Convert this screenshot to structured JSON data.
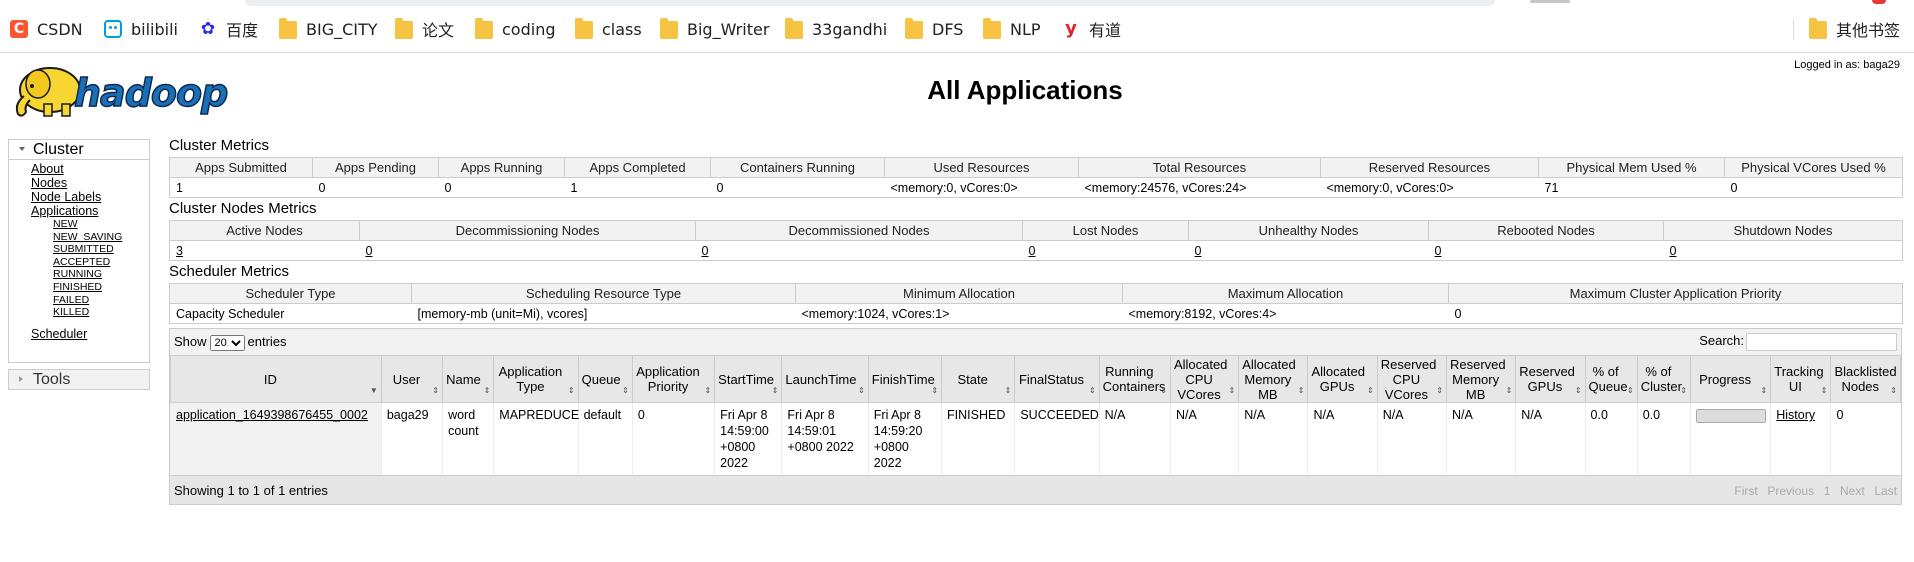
{
  "bookmarks": [
    {
      "label": "CSDN",
      "icon": "csdn-icon"
    },
    {
      "label": "bilibili",
      "icon": "bilibili-icon"
    },
    {
      "label": "百度",
      "icon": "baidu-icon"
    },
    {
      "label": "BIG_CITY",
      "icon": "folder-icon"
    },
    {
      "label": "论文",
      "icon": "folder-icon"
    },
    {
      "label": "coding",
      "icon": "folder-icon"
    },
    {
      "label": "class",
      "icon": "folder-icon"
    },
    {
      "label": "Big_Writer",
      "icon": "folder-icon"
    },
    {
      "label": "33gandhi",
      "icon": "folder-icon"
    },
    {
      "label": "DFS",
      "icon": "folder-icon"
    },
    {
      "label": "NLP",
      "icon": "folder-icon"
    },
    {
      "label": "有道",
      "icon": "youdao-icon"
    }
  ],
  "other_bookmarks": "其他书签",
  "page": {
    "title": "All Applications",
    "logged_in": "Logged in as: baga29",
    "logo_alt": "hadoop"
  },
  "nav": {
    "cluster": "Cluster",
    "cluster_links": [
      "About",
      "Nodes",
      "Node Labels",
      "Applications"
    ],
    "app_states": [
      "NEW",
      "NEW_SAVING",
      "SUBMITTED",
      "ACCEPTED",
      "RUNNING",
      "FINISHED",
      "FAILED",
      "KILLED"
    ],
    "scheduler": "Scheduler",
    "tools": "Tools"
  },
  "cluster_metrics": {
    "title": "Cluster Metrics",
    "headers": [
      "Apps Submitted",
      "Apps Pending",
      "Apps Running",
      "Apps Completed",
      "Containers Running",
      "Used Resources",
      "Total Resources",
      "Reserved Resources",
      "Physical Mem Used %",
      "Physical VCores Used %"
    ],
    "values": [
      "1",
      "0",
      "0",
      "1",
      "0",
      "<memory:0, vCores:0>",
      "<memory:24576, vCores:24>",
      "<memory:0, vCores:0>",
      "71",
      "0"
    ]
  },
  "nodes_metrics": {
    "title": "Cluster Nodes Metrics",
    "headers": [
      "Active Nodes",
      "Decommissioning Nodes",
      "Decommissioned Nodes",
      "Lost Nodes",
      "Unhealthy Nodes",
      "Rebooted Nodes",
      "Shutdown Nodes"
    ],
    "values": [
      "3",
      "0",
      "0",
      "0",
      "0",
      "0",
      "0"
    ]
  },
  "scheduler_metrics": {
    "title": "Scheduler Metrics",
    "headers": [
      "Scheduler Type",
      "Scheduling Resource Type",
      "Minimum Allocation",
      "Maximum Allocation",
      "Maximum Cluster Application Priority"
    ],
    "values": [
      "Capacity Scheduler",
      "[memory-mb (unit=Mi), vcores]",
      "<memory:1024, vCores:1>",
      "<memory:8192, vCores:4>",
      "0"
    ]
  },
  "apps_table": {
    "show": "Show",
    "entries_value": "20",
    "entries": "entries",
    "search_label": "Search:",
    "headers": [
      "ID",
      "User",
      "Name",
      "Application Type",
      "Queue",
      "Application Priority",
      "StartTime",
      "LaunchTime",
      "FinishTime",
      "State",
      "FinalStatus",
      "Running Containers",
      "Allocated CPU VCores",
      "Allocated Memory MB",
      "Allocated GPUs",
      "Reserved CPU VCores",
      "Reserved Memory MB",
      "Reserved GPUs",
      "% of Queue",
      "% of Cluster",
      "Progress",
      "Tracking UI",
      "Blacklisted Nodes"
    ],
    "rows": [
      {
        "id": "application_1649398676455_0002",
        "user": "baga29",
        "name": "word count",
        "type": "MAPREDUCE",
        "queue": "default",
        "priority": "0",
        "start": "Fri Apr 8 14:59:00 +0800 2022",
        "launch": "Fri Apr 8 14:59:01 +0800 2022",
        "finish": "Fri Apr 8 14:59:20 +0800 2022",
        "state": "FINISHED",
        "final_status": "SUCCEEDED",
        "running_containers": "N/A",
        "alloc_vcores": "N/A",
        "alloc_mem": "N/A",
        "alloc_gpus": "N/A",
        "res_vcores": "N/A",
        "res_mem": "N/A",
        "res_gpus": "N/A",
        "pct_queue": "0.0",
        "pct_cluster": "0.0",
        "progress": 1.0,
        "tracking": "History",
        "blacklisted": "0"
      }
    ],
    "info": "Showing 1 to 1 of 1 entries",
    "pager": [
      "First",
      "Previous",
      "1",
      "Next",
      "Last"
    ]
  },
  "colors": {
    "header_bg": "#f2f2f2",
    "border": "#cccccc",
    "logo_yellow": "#f7d633",
    "logo_blue": "#1a6fb5"
  }
}
